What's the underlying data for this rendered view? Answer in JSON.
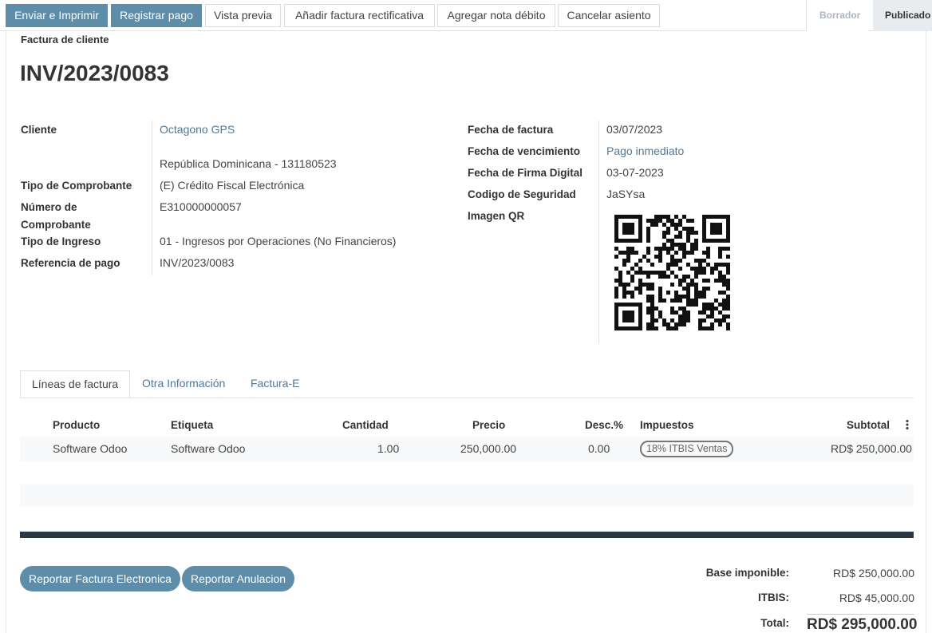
{
  "toolbar": {
    "send_print": "Enviar e Imprimir",
    "register_payment": "Registrar pago",
    "preview": "Vista previa",
    "credit_note": "Añadir factura rectificativa",
    "debit_note": "Agregar nota débito",
    "cancel_entry": "Cancelar asiento"
  },
  "statusbar": {
    "draft": "Borrador",
    "posted": "Publicado"
  },
  "document": {
    "type": "Factura de cliente",
    "name": "INV/2023/0083"
  },
  "left_fields": {
    "customer_label": "Cliente",
    "customer_value": "Octagono GPS",
    "customer_address": "República Dominicana - 131180523",
    "voucher_type_label": "Tipo de Comprobante",
    "voucher_type_value": "(E) Crédito Fiscal Electrónica",
    "voucher_number_label_1": "Número de",
    "voucher_number_label_2": "Comprobante",
    "voucher_number_value": "E310000000057",
    "income_type_label": "Tipo de Ingreso",
    "income_type_value": "01 - Ingresos por Operaciones (No Financieros)",
    "payment_ref_label": "Referencia de pago",
    "payment_ref_value": "INV/2023/0083"
  },
  "right_fields": {
    "invoice_date_label": "Fecha de factura",
    "invoice_date_value": "03/07/2023",
    "due_date_label": "Fecha de vencimiento",
    "due_date_value": "Pago inmediato",
    "sign_date_label": "Fecha de Firma Digital",
    "sign_date_value": "03-07-2023",
    "security_code_label": "Codigo de Seguridad",
    "security_code_value": "JaSYsa",
    "qr_label": "Imagen QR"
  },
  "tabs": {
    "lines": "Líneas de factura",
    "other_info": "Otra Información",
    "einvoice": "Factura-E"
  },
  "table": {
    "headers": {
      "product": "Producto",
      "label": "Etiqueta",
      "quantity": "Cantidad",
      "price": "Precio",
      "discount": "Desc.%",
      "taxes": "Impuestos",
      "subtotal": "Subtotal"
    },
    "rows": [
      {
        "product": "Software Odoo",
        "label": "Software Odoo",
        "quantity": "1.00",
        "price": "250,000.00",
        "discount": "0.00",
        "tax": "18% ITBIS Ventas",
        "subtotal": "RD$ 250,000.00"
      }
    ]
  },
  "actions": {
    "report_invoice": "Reportar Factura Electronica",
    "report_cancel": "Reportar Anulacion"
  },
  "totals": {
    "base_label": "Base imponible:",
    "base_value": "RD$ 250,000.00",
    "itbis_label": "ITBIS:",
    "itbis_value": "RD$ 45,000.00",
    "total_label": "Total:",
    "total_value": "RD$ 295,000.00"
  },
  "colors": {
    "primary": "#5d8da8",
    "link": "#4f7897",
    "dark_bar": "#2b3842"
  }
}
